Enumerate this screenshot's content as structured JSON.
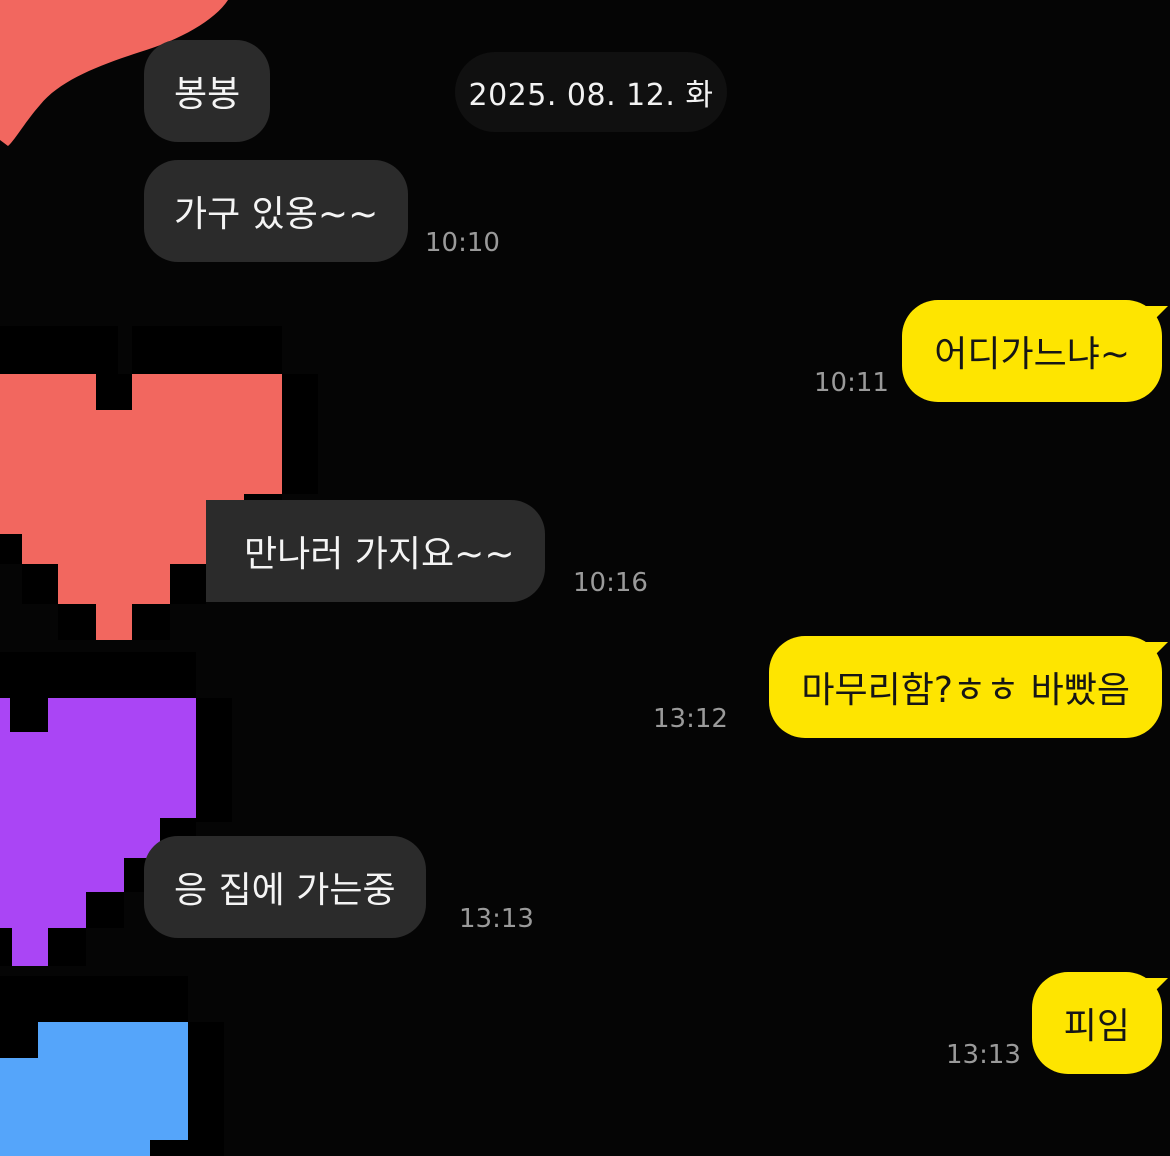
{
  "date_separator": "2025. 08. 12. 화",
  "messages": [
    {
      "side": "in",
      "text": "봉봉",
      "time": ""
    },
    {
      "side": "in",
      "text": "가구 있옹~~",
      "time": "10:10"
    },
    {
      "side": "out",
      "text": "어디가느냐~",
      "time": "10:11"
    },
    {
      "side": "in",
      "text": "만나러 가지요~~",
      "time": "10:16"
    },
    {
      "side": "out",
      "text": "마무리함?ㅎㅎ 바빴음",
      "time": "13:12"
    },
    {
      "side": "in",
      "text": "응 집에 가는중",
      "time": "13:13"
    },
    {
      "side": "out",
      "text": "피임",
      "time": "13:13"
    }
  ],
  "colors": {
    "background": "#050505",
    "incoming_bubble": "#2b2b2b",
    "outgoing_bubble": "#fee500",
    "heart_red": "#f2675f",
    "heart_purple": "#aa45f5",
    "heart_blue": "#55a5fa"
  },
  "stickers": [
    "red-blob-sticker",
    "red-pixel-heart-sticker",
    "purple-pixel-heart-sticker",
    "blue-pixel-heart-sticker"
  ]
}
